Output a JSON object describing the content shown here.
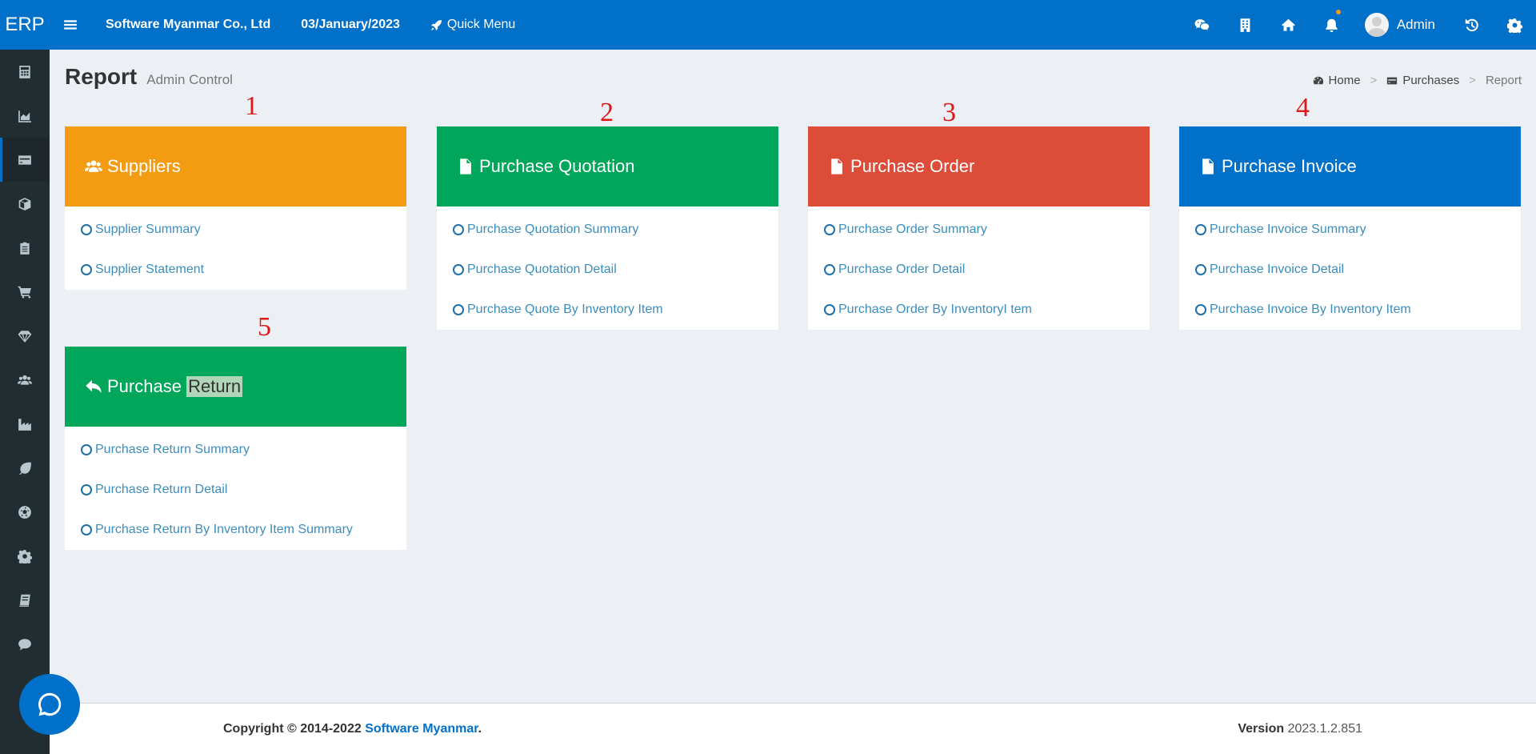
{
  "app": {
    "logo": "ERP",
    "company": "Software Myanmar Co., Ltd",
    "date": "03/January/2023",
    "quick_menu": "Quick Menu",
    "user": "Admin"
  },
  "colors": {
    "brand_blue": "#0170c9",
    "sidebar": "#222d32",
    "orange": "#f39c12",
    "green": "#00a65a",
    "red": "#dd4b39",
    "annotation_red": "#e01818"
  },
  "sidebar": {
    "items": [
      {
        "icon": "calculator-icon",
        "active": false
      },
      {
        "icon": "area-chart-icon",
        "active": false
      },
      {
        "icon": "credit-card-icon",
        "active": true
      },
      {
        "icon": "cube-icon",
        "active": false
      },
      {
        "icon": "clipboard-icon",
        "active": false
      },
      {
        "icon": "shopping-cart-icon",
        "active": false
      },
      {
        "icon": "diamond-icon",
        "active": false
      },
      {
        "icon": "users-icon",
        "active": false
      },
      {
        "icon": "industry-icon",
        "active": false
      },
      {
        "icon": "leaf-icon",
        "active": false
      },
      {
        "icon": "soccer-ball-icon",
        "active": false
      },
      {
        "icon": "gear-icon",
        "active": false
      },
      {
        "icon": "book-icon",
        "active": false
      },
      {
        "icon": "comment-icon",
        "active": false
      }
    ]
  },
  "topbar": {
    "icons": [
      "wechat-icon",
      "building-icon",
      "home-icon",
      "bell-icon",
      "history-icon",
      "gear-icon"
    ]
  },
  "header": {
    "title": "Report",
    "subtitle": "Admin Control",
    "breadcrumb": [
      "Home",
      "Purchases",
      "Report"
    ]
  },
  "panels": [
    {
      "number": "1",
      "title": "Suppliers",
      "links": [
        "Supplier Summary",
        "Supplier Statement"
      ]
    },
    {
      "number": "2",
      "title": "Purchase Quotation",
      "links": [
        "Purchase Quotation Summary",
        "Purchase Quotation Detail",
        "Purchase Quote By Inventory Item"
      ]
    },
    {
      "number": "3",
      "title": "Purchase Order",
      "links": [
        "Purchase Order Summary",
        "Purchase Order Detail",
        "Purchase Order By InventoryI tem"
      ]
    },
    {
      "number": "4",
      "title": "Purchase Invoice",
      "links": [
        "Purchase Invoice Summary",
        "Purchase Invoice Detail",
        "Purchase Invoice By Inventory Item"
      ]
    },
    {
      "number": "5",
      "title_part1": "Purchase",
      "title_part2": "Return",
      "links": [
        "Purchase Return Summary",
        "Purchase Return Detail",
        "Purchase Return By Inventory Item Summary"
      ]
    }
  ],
  "footer": {
    "copyright": "Copyright © 2014-2022",
    "company_link": "Software Myanmar",
    "period": ".",
    "version_label": "Version",
    "version_value": "2023.1.2.851"
  }
}
